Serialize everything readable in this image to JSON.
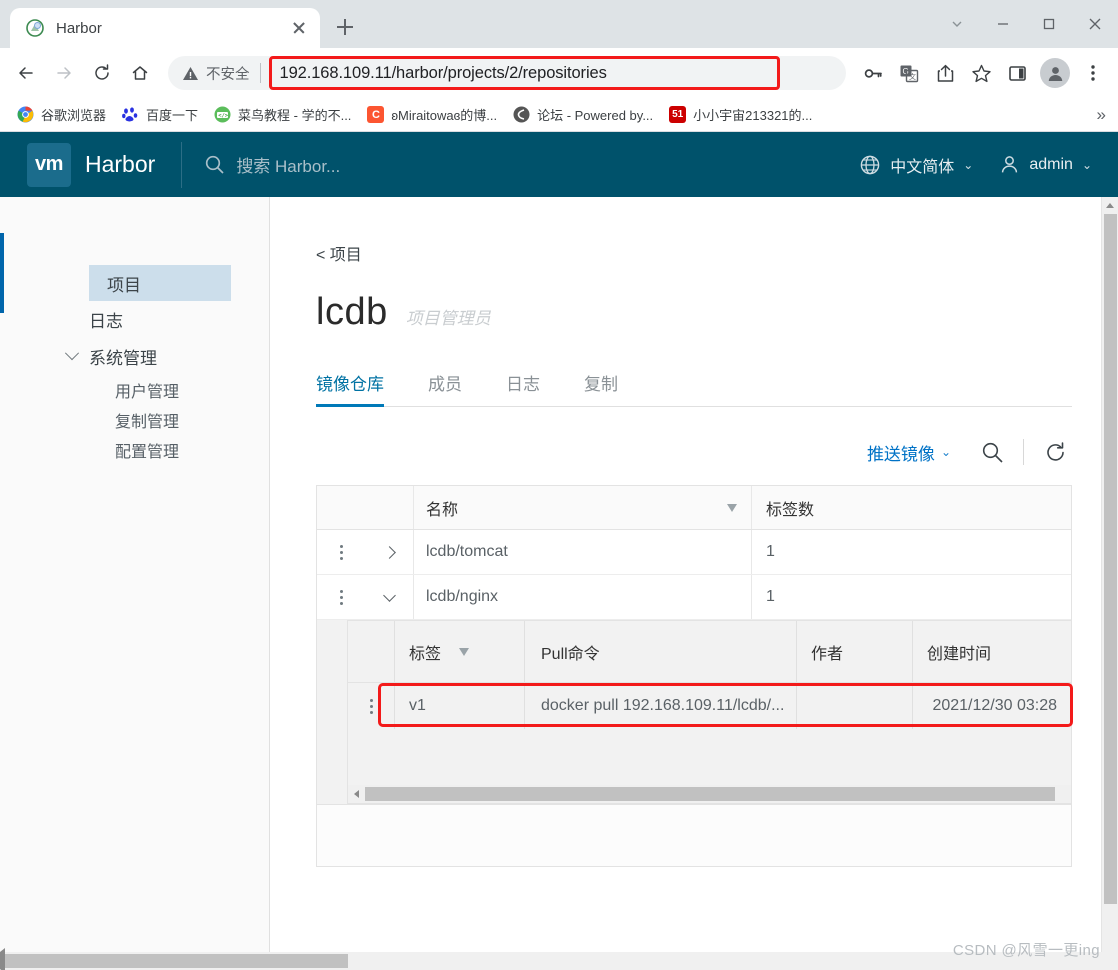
{
  "browser": {
    "tab": {
      "title": "Harbor",
      "favicon": "harbor-favicon",
      "close_label": "×"
    },
    "new_tab_label": "+",
    "window_controls": {
      "chevron": "⌄",
      "minimize": "—",
      "maximize": "□",
      "close": "✕"
    },
    "nav": {
      "back": "←",
      "forward": "→",
      "reload": "⟳",
      "home": "⌂"
    },
    "omnibox": {
      "security_label": "不安全",
      "url": "192.168.109.11/harbor/projects/2/repositories",
      "highlight_color": "#f31a1a"
    },
    "toolbar_icons": [
      "key-icon",
      "translate-icon",
      "share-icon",
      "bookmark-star-icon",
      "side-panel-icon",
      "profile-avatar",
      "chrome-menu-icon"
    ],
    "bookmarks": [
      {
        "label": "谷歌浏览器",
        "icon": "chrome-icon",
        "color": "#4285f4"
      },
      {
        "label": "百度一下",
        "icon": "baidu-icon",
        "color": "#2932e1"
      },
      {
        "label": "菜鸟教程 - 学的不...",
        "icon": "runoob-icon",
        "color": "#4caf50"
      },
      {
        "label": "ʚMiraitowaɞ的博...",
        "icon": "csdn-c-icon",
        "color": "#fc5531"
      },
      {
        "label": "论坛 - Powered by...",
        "icon": "forum-icon",
        "color": "#555555"
      },
      {
        "label": "小小宇宙213321的...",
        "icon": "51cto-icon",
        "color": "#cc0000"
      }
    ],
    "bookmarks_overflow": "»"
  },
  "harbor": {
    "logo_text": "vm",
    "app_title": "Harbor",
    "search_placeholder": "搜索 Harbor...",
    "language": "中文简体",
    "user": "admin",
    "sidebar": {
      "items": [
        {
          "label": "项目",
          "active": true,
          "type": "item"
        },
        {
          "label": "日志",
          "active": false,
          "type": "item"
        },
        {
          "label": "系统管理",
          "active": false,
          "type": "group",
          "expanded": true
        },
        {
          "label": "用户管理",
          "active": false,
          "type": "sub"
        },
        {
          "label": "复制管理",
          "active": false,
          "type": "sub"
        },
        {
          "label": "配置管理",
          "active": false,
          "type": "sub"
        }
      ]
    },
    "breadcrumb": "< 项目",
    "project": {
      "name": "lcdb",
      "role": "项目管理员"
    },
    "tabs": [
      {
        "label": "镜像仓库",
        "active": true
      },
      {
        "label": "成员",
        "active": false
      },
      {
        "label": "日志",
        "active": false
      },
      {
        "label": "复制",
        "active": false
      }
    ],
    "actions": {
      "push_image": "推送镜像",
      "push_caret": "⌄",
      "search_icon": "search-icon",
      "refresh_icon": "refresh-icon"
    },
    "repo_table": {
      "columns": [
        "",
        "",
        "名称",
        "标签数"
      ],
      "rows": [
        {
          "name": "lcdb/tomcat",
          "tags": "1",
          "expanded": false
        },
        {
          "name": "lcdb/nginx",
          "tags": "1",
          "expanded": true
        }
      ]
    },
    "tag_table": {
      "columns": [
        "标签",
        "Pull命令",
        "作者",
        "创建时间"
      ],
      "rows": [
        {
          "tag": "v1",
          "pull": "docker pull 192.168.109.11/lcdb/...",
          "author": "",
          "created": "2021/12/30 03:28",
          "highlighted": true
        }
      ]
    }
  },
  "watermark": "CSDN @风雪一更ing"
}
